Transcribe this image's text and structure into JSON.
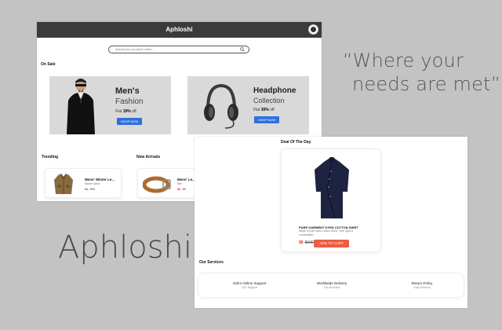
{
  "tagline": {
    "line1": "“Where your",
    "line2": "needs are met”"
  },
  "brand": "Aphloshi",
  "screen1": {
    "app_title": "Aphloshi",
    "search_placeholder": "search your product name...",
    "on_sale_title": "On Sale",
    "banner_men": {
      "title": "Men's",
      "subtitle": "Fashion",
      "off_prefix": "Flat ",
      "off_value": "19%",
      "off_suffix": " off",
      "button": "SHOP NOW"
    },
    "banner_headphone": {
      "title": "Headphone",
      "subtitle": "Collection",
      "off_prefix": "Flat ",
      "off_value": "30%",
      "off_suffix": " off",
      "button": "SHOP NOW"
    },
    "trending_title": "Trending",
    "new_arrivals_title": "New Arrivals",
    "trending_product": {
      "name": "Mens' Winter Le...",
      "sub": "Winter Wear",
      "price": "$4",
      "old_price": "$10"
    },
    "new_product": {
      "name": "Mens' Le...",
      "sub": "Belt",
      "price": "$6",
      "old_price": "$8"
    }
  },
  "screen2": {
    "deal_title": "Deal Of The Day",
    "deal_product": {
      "name": "PURE GARMENT DYED COTTON SHIRT",
      "desc": "Made of pure dyed cotton fabric. Soft, light & comfortable.",
      "price": "$8",
      "old_price": "$100"
    },
    "add_to_cart": "ADD TO CART",
    "services_title": "Our Services",
    "services": [
      {
        "title": "24hrs Online Support",
        "desc": "24/7 Support"
      },
      {
        "title": "Worldwide Delivery",
        "desc": "For all orders"
      },
      {
        "title": "Return Policy",
        "desc": "Easy Returns"
      }
    ]
  },
  "colors": {
    "topbar": "#3b3b3b",
    "accent_blue": "#2f6fde",
    "cta_orange": "#ef5b40",
    "price_red": "#e53935"
  }
}
